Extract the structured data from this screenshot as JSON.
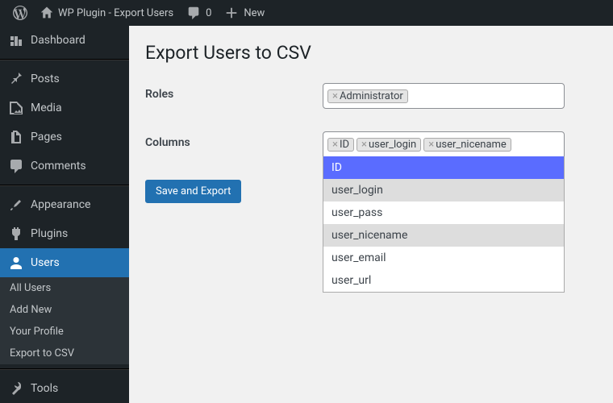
{
  "topbar": {
    "site_title": "WP Plugin - Export Users",
    "comment_count": "0",
    "new_label": "New"
  },
  "sidebar": {
    "dashboard": "Dashboard",
    "posts": "Posts",
    "media": "Media",
    "pages": "Pages",
    "comments": "Comments",
    "appearance": "Appearance",
    "plugins": "Plugins",
    "users": "Users",
    "tools": "Tools",
    "sub": {
      "all_users": "All Users",
      "add_new": "Add New",
      "your_profile": "Your Profile",
      "export_csv": "Export to CSV"
    }
  },
  "page": {
    "title": "Export Users to CSV",
    "roles_label": "Roles",
    "columns_label": "Columns",
    "submit": "Save and Export"
  },
  "roles": {
    "selected": [
      {
        "label": "Administrator"
      }
    ]
  },
  "columns": {
    "selected": [
      {
        "label": "ID"
      },
      {
        "label": "user_login"
      },
      {
        "label": "user_nicename"
      }
    ],
    "dropdown": [
      {
        "label": "ID",
        "state": "highlight"
      },
      {
        "label": "user_login",
        "state": "selected"
      },
      {
        "label": "user_pass",
        "state": ""
      },
      {
        "label": "user_nicename",
        "state": "selected"
      },
      {
        "label": "user_email",
        "state": ""
      },
      {
        "label": "user_url",
        "state": ""
      }
    ]
  }
}
